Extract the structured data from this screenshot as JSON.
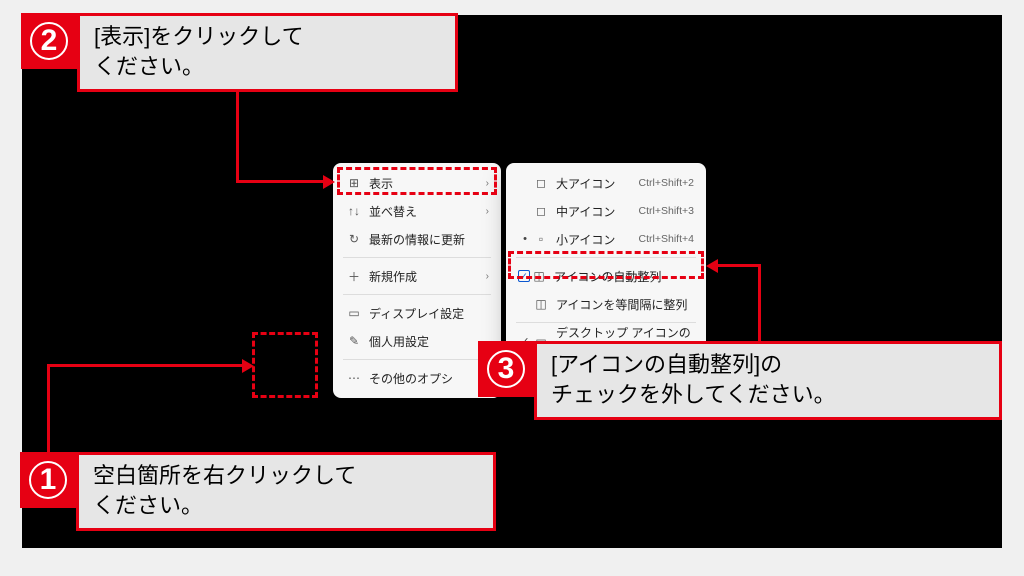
{
  "menu1": {
    "items": [
      {
        "icon": "⊞",
        "label": "表示",
        "arrow": "›"
      },
      {
        "icon": "↑↓",
        "label": "並べ替え",
        "arrow": "›"
      },
      {
        "icon": "↻",
        "label": "最新の情報に更新"
      }
    ],
    "items2": [
      {
        "icon": "＋",
        "label": "新規作成",
        "arrow": "›"
      }
    ],
    "items3": [
      {
        "icon": "▭",
        "label": "ディスプレイ設定"
      },
      {
        "icon": "✎",
        "label": "個人用設定"
      }
    ],
    "items4": [
      {
        "icon": "⋯",
        "label": "その他のオプシ"
      }
    ]
  },
  "menu2": {
    "items": [
      {
        "check": "",
        "icon": "◻",
        "label": "大アイコン",
        "shortcut": "Ctrl+Shift+2"
      },
      {
        "check": "",
        "icon": "◻",
        "label": "中アイコン",
        "shortcut": "Ctrl+Shift+3"
      },
      {
        "check": "•",
        "icon": "▫",
        "label": "小アイコン",
        "shortcut": "Ctrl+Shift+4"
      }
    ],
    "items2": [
      {
        "checkblue": "✓",
        "icon": "◫",
        "label": "アイコンの自動整列"
      },
      {
        "check": "",
        "icon": "◫",
        "label": "アイコンを等間隔に整列"
      }
    ],
    "items3": [
      {
        "check": "✓",
        "icon": "▭",
        "label": "デスクトップ アイコンの表示"
      }
    ]
  },
  "ann": {
    "n1": "1",
    "t1a": "空白箇所を右クリックして",
    "t1b": "ください。",
    "n2": "2",
    "t2a": "[表示]をクリックして",
    "t2b": "ください。",
    "n3": "3",
    "t3a": "[アイコンの自動整列]の",
    "t3b": "チェックを外してください。"
  }
}
